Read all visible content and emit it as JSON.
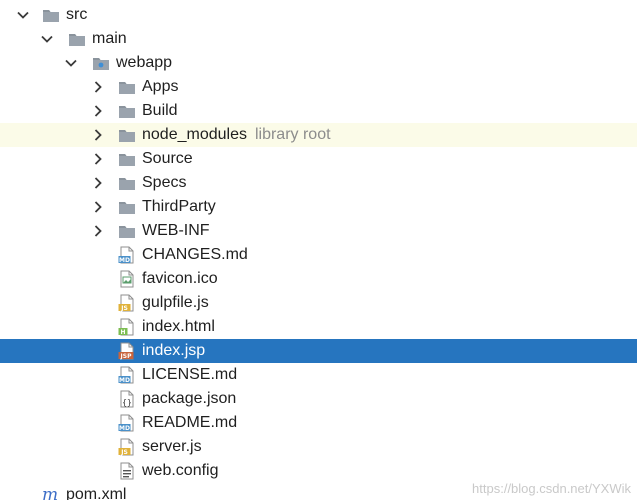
{
  "tree": [
    {
      "label": "src",
      "hint": "",
      "depth": 0,
      "arrow": "down",
      "icon": "folder-icon"
    },
    {
      "label": "main",
      "hint": "",
      "depth": 1,
      "arrow": "down",
      "icon": "folder-icon"
    },
    {
      "label": "webapp",
      "hint": "",
      "depth": 2,
      "arrow": "down",
      "icon": "web-folder-icon"
    },
    {
      "label": "Apps",
      "hint": "",
      "depth": 3,
      "arrow": "right",
      "icon": "folder-icon"
    },
    {
      "label": "Build",
      "hint": "",
      "depth": 3,
      "arrow": "right",
      "icon": "folder-icon"
    },
    {
      "label": "node_modules",
      "hint": "library root",
      "depth": 3,
      "arrow": "right",
      "icon": "folder-icon",
      "state": "highlight"
    },
    {
      "label": "Source",
      "hint": "",
      "depth": 3,
      "arrow": "right",
      "icon": "folder-icon"
    },
    {
      "label": "Specs",
      "hint": "",
      "depth": 3,
      "arrow": "right",
      "icon": "folder-icon"
    },
    {
      "label": "ThirdParty",
      "hint": "",
      "depth": 3,
      "arrow": "right",
      "icon": "folder-icon"
    },
    {
      "label": "WEB-INF",
      "hint": "",
      "depth": 3,
      "arrow": "right",
      "icon": "folder-icon"
    },
    {
      "label": "CHANGES.md",
      "hint": "",
      "depth": 3,
      "arrow": "",
      "icon": "markdown-file-icon",
      "badge": "MD",
      "badgeColor": "#4a90c9"
    },
    {
      "label": "favicon.ico",
      "hint": "",
      "depth": 3,
      "arrow": "",
      "icon": "image-file-icon",
      "badge": "",
      "badgeColor": "#5b9e6d"
    },
    {
      "label": "gulpfile.js",
      "hint": "",
      "depth": 3,
      "arrow": "",
      "icon": "javascript-file-icon",
      "badge": "JS",
      "badgeColor": "#e0b23a"
    },
    {
      "label": "index.html",
      "hint": "",
      "depth": 3,
      "arrow": "",
      "icon": "html-file-icon",
      "badge": "H",
      "badgeColor": "#7dbd52"
    },
    {
      "label": "index.jsp",
      "hint": "",
      "depth": 3,
      "arrow": "",
      "icon": "jsp-file-icon",
      "badge": "JSP",
      "badgeColor": "#c8643c",
      "state": "selected"
    },
    {
      "label": "LICENSE.md",
      "hint": "",
      "depth": 3,
      "arrow": "",
      "icon": "markdown-file-icon",
      "badge": "MD",
      "badgeColor": "#4a90c9"
    },
    {
      "label": "package.json",
      "hint": "",
      "depth": 3,
      "arrow": "",
      "icon": "json-file-icon",
      "badge": "{}",
      "badgeColor": "#888888"
    },
    {
      "label": "README.md",
      "hint": "",
      "depth": 3,
      "arrow": "",
      "icon": "markdown-file-icon",
      "badge": "MD",
      "badgeColor": "#4a90c9"
    },
    {
      "label": "server.js",
      "hint": "",
      "depth": 3,
      "arrow": "",
      "icon": "javascript-file-icon",
      "badge": "JS",
      "badgeColor": "#e0b23a"
    },
    {
      "label": "web.config",
      "hint": "",
      "depth": 3,
      "arrow": "",
      "icon": "config-file-icon",
      "badge": "",
      "badgeColor": "#666666"
    },
    {
      "label": "pom.xml",
      "hint": "",
      "depth": 1,
      "arrow": "",
      "icon": "maven-icon",
      "badge": "",
      "badgeColor": "#3d6ec7"
    }
  ],
  "watermark": "https://blog.csdn.net/YXWik",
  "colors": {
    "selected_bg": "#2675bf",
    "highlight_bg": "#fbfbe8",
    "folder": "#9aa3ad",
    "hint": "#8c8c8c"
  }
}
